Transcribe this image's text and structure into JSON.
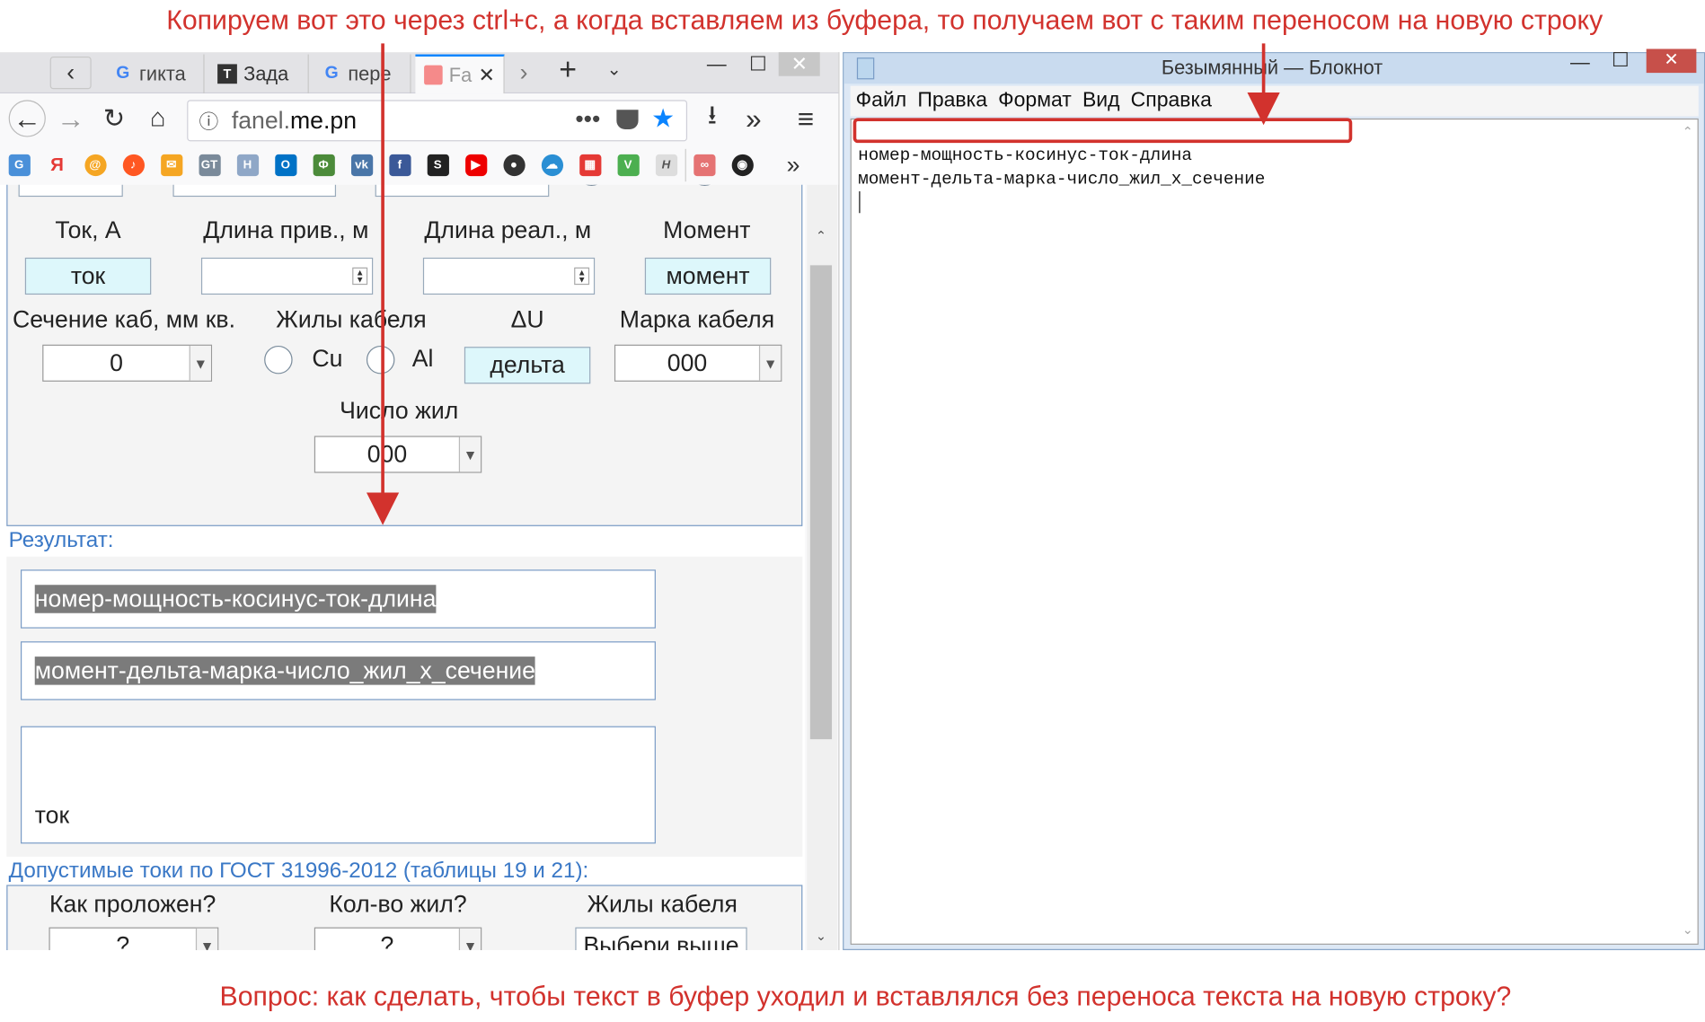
{
  "annotations": {
    "top": "Копируем вот это через ctrl+c, а когда вставляем из буфера, то получаем вот с таким переносом на новую строку",
    "bottom": "Вопрос: как сделать, чтобы текст в буфер уходил и вставлялся без переноса текста на новую строку?",
    "accent": "#d2322d"
  },
  "browser": {
    "tabs": [
      {
        "label": "гикта",
        "icon": "google-icon"
      },
      {
        "label": "Зада",
        "icon": "tproger-icon"
      },
      {
        "label": "пере",
        "icon": "google-icon"
      },
      {
        "label": "Fa",
        "icon": "site-icon",
        "active": true
      }
    ],
    "url_host": "fanel.",
    "url_domain": "me.pn",
    "bookmarks": [
      "translate",
      "yandex",
      "mail-at",
      "music",
      "email",
      "gtranslate",
      "h",
      "outlook",
      "fns",
      "vk",
      "facebook",
      "s",
      "youtube",
      "wb",
      "cloud",
      "calendar",
      "v",
      "h2",
      "redux",
      "github"
    ]
  },
  "form": {
    "labels": {
      "current": "Ток, А",
      "len_given": "Длина прив., м",
      "len_real": "Длина реал., м",
      "moment": "Момент",
      "section": "Сечение каб, мм кв.",
      "cores": "Жилы кабеля",
      "delta_u": "ΔU",
      "brand": "Марка кабеля",
      "core_count": "Число жил"
    },
    "values": {
      "current": "ток",
      "moment": "момент",
      "section": "0",
      "delta": "дельта",
      "brand": "000",
      "core_count": "000"
    },
    "radios": {
      "cu": "Cu",
      "al": "Al"
    }
  },
  "result": {
    "heading": "Результат:",
    "line1": "номер-мощность-косинус-ток-длина",
    "line2": "момент-дельта-марка-число_жил_х_сечение",
    "line3": "ток"
  },
  "gost": {
    "heading": "Допустимые токи по ГОСТ 31996-2012 (таблицы 19 и 21):",
    "how_label": "Как проложен?",
    "count_label": "Кол-во жил?",
    "cores_label": "Жилы кабеля",
    "how_value": "?",
    "count_value": "?",
    "cores_value": "Выбери выше"
  },
  "notepad": {
    "title": "Безымянный — Блокнот",
    "menu": [
      "Файл",
      "Правка",
      "Формат",
      "Вид",
      "Справка"
    ],
    "line1": "номер-мощность-косинус-ток-длина",
    "line2": "момент-дельта-марка-число_жил_х_сечение"
  }
}
